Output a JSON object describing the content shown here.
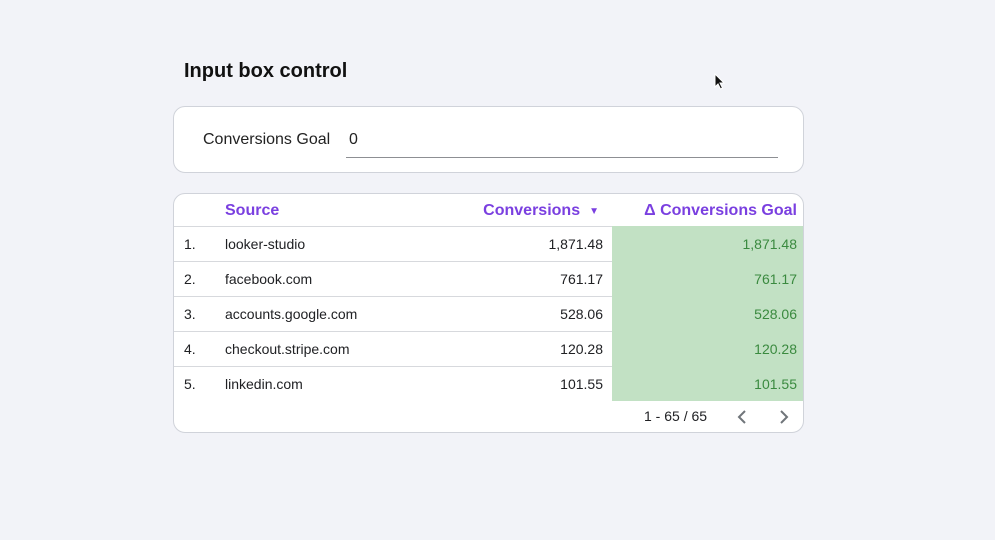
{
  "title": "Input box control",
  "input_control": {
    "label": "Conversions Goal",
    "value": "0"
  },
  "table": {
    "columns": {
      "source": "Source",
      "conversions": "Conversions",
      "delta": "Δ Conversions Goal"
    },
    "sort": {
      "column": "Conversions",
      "direction": "descending",
      "icon": "sort-desc-icon"
    },
    "rows": [
      {
        "index": "1.",
        "source": "looker-studio",
        "conversions": "1,871.48",
        "delta": "1,871.48"
      },
      {
        "index": "2.",
        "source": "facebook.com",
        "conversions": "761.17",
        "delta": "761.17"
      },
      {
        "index": "3.",
        "source": "accounts.google.com",
        "conversions": "528.06",
        "delta": "528.06"
      },
      {
        "index": "4.",
        "source": "checkout.stripe.com",
        "conversions": "120.28",
        "delta": "120.28"
      },
      {
        "index": "5.",
        "source": "linkedin.com",
        "conversions": "101.55",
        "delta": "101.55"
      }
    ],
    "pagination": "1 - 65 / 65"
  },
  "colors": {
    "accent": "#7a3fe0",
    "positive_fill": "#c2e1c4",
    "positive_text": "#3a8a3f",
    "background": "#f2f3f8"
  }
}
